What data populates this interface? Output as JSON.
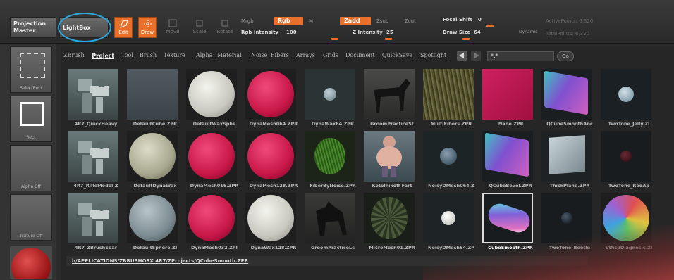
{
  "topbar": {
    "projection_master": "Projection Master",
    "lightbox": "LightBox",
    "edit": "Edit",
    "draw": "Draw",
    "move": "Move",
    "scale": "Scale",
    "rotate": "Rotate",
    "mrgb": "Mrgb",
    "rgb": "Rgb",
    "m": "M",
    "zadd": "Zadd",
    "zsub": "Zsub",
    "zcut": "Zcut",
    "rgb_intensity_label": "Rgb Intensity",
    "rgb_intensity_value": "100",
    "z_intensity_label": "Z Intensity",
    "z_intensity_value": "25",
    "focal_shift_label": "Focal Shift",
    "focal_shift_value": "0",
    "draw_size_label": "Draw Size",
    "draw_size_value": "64",
    "dynamic": "Dynamic",
    "active_points": "ActivePoints: 6,320",
    "total_points": "TotalPoints: 6,320"
  },
  "left": {
    "selectrect": "SelectRect",
    "rect": "Rect",
    "alpha_off": "Alpha Off",
    "texture_off": "Texture Off"
  },
  "tabs": [
    "ZBrush",
    "Project",
    "Tool",
    "Brush",
    "Texture",
    "Alpha",
    "Material",
    "Noise",
    "Fibers",
    "Arrays",
    "Grids",
    "Document",
    "QuickSave",
    "Spotlight"
  ],
  "active_tab": "Project",
  "search": {
    "value": "*.*",
    "go": "Go"
  },
  "items": [
    {
      "name": "4R7_QuickHeavy",
      "kind": "mech"
    },
    {
      "name": "DefaultCube.ZPR",
      "kind": "cube"
    },
    {
      "name": "DefaultWaxSphe",
      "kind": "white"
    },
    {
      "name": "DynaMesh064.ZPR",
      "kind": "red"
    },
    {
      "name": "DynaWax64.ZPR",
      "kind": "small"
    },
    {
      "name": "GroomPracticeSt",
      "kind": "horse"
    },
    {
      "name": "MultiFibers.ZPR",
      "kind": "fur"
    },
    {
      "name": "Plane.ZPR",
      "kind": "plane"
    },
    {
      "name": "QCubeSmoothAnc",
      "kind": "qcube"
    },
    {
      "name": "TwoTone_Jelly.Zl",
      "kind": "jelly"
    },
    {
      "name": "4R7_RifleModel.Z",
      "kind": "rifle"
    },
    {
      "name": "DefaultDynaWax",
      "kind": "wax"
    },
    {
      "name": "DynaMesh016.ZPR",
      "kind": "red"
    },
    {
      "name": "DynaMesh128.ZPR",
      "kind": "red"
    },
    {
      "name": "FiberByNoise.ZPR",
      "kind": "grass"
    },
    {
      "name": "Kotelnikoff Fart",
      "kind": "ogre"
    },
    {
      "name": "NoisyDMesh064.Z",
      "kind": "noisy"
    },
    {
      "name": "QCubeBevel.ZPR",
      "kind": "qcube"
    },
    {
      "name": "ThickPlane.ZPR",
      "kind": "thick"
    },
    {
      "name": "TwoTone_RedAp",
      "kind": "dark"
    },
    {
      "name": "4R7_ZBrushSear",
      "kind": "mech2"
    },
    {
      "name": "DefaultSphere.ZI",
      "kind": "grey"
    },
    {
      "name": "DynaMesh032.ZPI",
      "kind": "red"
    },
    {
      "name": "DynaWax128.ZPR",
      "kind": "white"
    },
    {
      "name": "GroomPracticeLc",
      "kind": "dog"
    },
    {
      "name": "MicroMesh01.ZPR",
      "kind": "micro"
    },
    {
      "name": "NoisyDMesh64.ZP",
      "kind": "whitesmall"
    },
    {
      "name": "CubeSmooth.ZPR",
      "kind": "capsule",
      "selected": true
    },
    {
      "name": "TwoTone_Beetle",
      "kind": "beetle"
    },
    {
      "name": "VDispDiagnosic.ZI",
      "kind": "rainbow"
    }
  ],
  "path": "h/APPLICATIONS/ZBRUSHOSX 4R7/ZProjects/QCubeSmooth.ZPR",
  "colors": {
    "accent": "#e8702a",
    "highlight": "#2aa8e0"
  }
}
